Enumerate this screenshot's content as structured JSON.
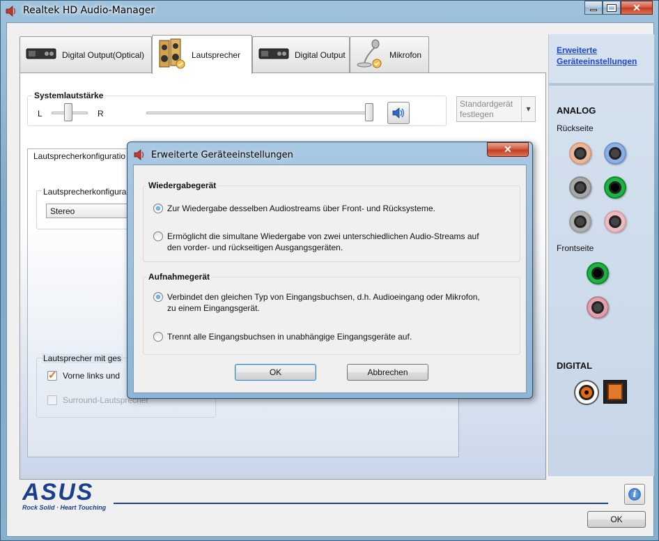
{
  "window": {
    "title": "Realtek HD Audio-Manager"
  },
  "tabs": [
    {
      "label": "Digital Output(Optical)",
      "icon": "digital-output-device-icon"
    },
    {
      "label": "Lautsprecher",
      "icon": "speaker-icon",
      "active": true
    },
    {
      "label": "Digital Output",
      "icon": "digital-output-device-icon"
    },
    {
      "label": "Mikrofon",
      "icon": "microphone-icon"
    }
  ],
  "volume": {
    "group_label": "Systemlautstärke",
    "left_label": "L",
    "right_label": "R",
    "balance": 0.5,
    "level": 1.0
  },
  "standard_device": {
    "label_line1": "Standardgerät",
    "label_line2": "festlegen"
  },
  "speaker_config": {
    "box_label": "Lautsprecherkonfiguratio",
    "inner_label": "Lautsprecherkonfigura",
    "selected": "Stereo",
    "fullrange_label": "Lautsprecher mit ges",
    "front_checkbox": "Vorne links und",
    "surround_checkbox": "Surround-Lautsprecher"
  },
  "right_panel": {
    "advanced_link_line1": "Erweiterte",
    "advanced_link_line2": "Geräteeinstellungen",
    "analog": "ANALOG",
    "back": "Rückseite",
    "front": "Frontseite",
    "digital": "DIGITAL",
    "colors": {
      "orange": "#d99a7a",
      "blue": "#6e94cf",
      "grey": "#8c8c8c",
      "green": "#0f8a2a",
      "pink": "#d9a0a8"
    }
  },
  "brand": {
    "logo": "ASUS",
    "tagline": "Rock Solid · Heart Touching"
  },
  "bottom": {
    "ok": "OK"
  },
  "dialog": {
    "title": "Erweiterte Geräteeinstellungen",
    "playback_group": "Wiedergabegerät",
    "playback_opt1": "Zur Wiedergabe desselben Audiostreams über Front- und Rücksysteme.",
    "playback_opt2_line1": "Ermöglicht die simultane Wiedergabe von zwei unterschiedlichen Audio-Streams auf",
    "playback_opt2_line2": "den vorder- und rückseitigen Ausgangsgeräten.",
    "record_group": "Aufnahmegerät",
    "record_opt1_line1": "Verbindet den gleichen Typ von Eingangsbuchsen, d.h. Audioeingang oder Mikrofon,",
    "record_opt1_line2": "zu einem Eingangsgerät.",
    "record_opt2": "Trennt alle Eingangsbuchsen in unabhängige Eingangsgeräte auf.",
    "ok": "OK",
    "cancel": "Abbrechen"
  }
}
